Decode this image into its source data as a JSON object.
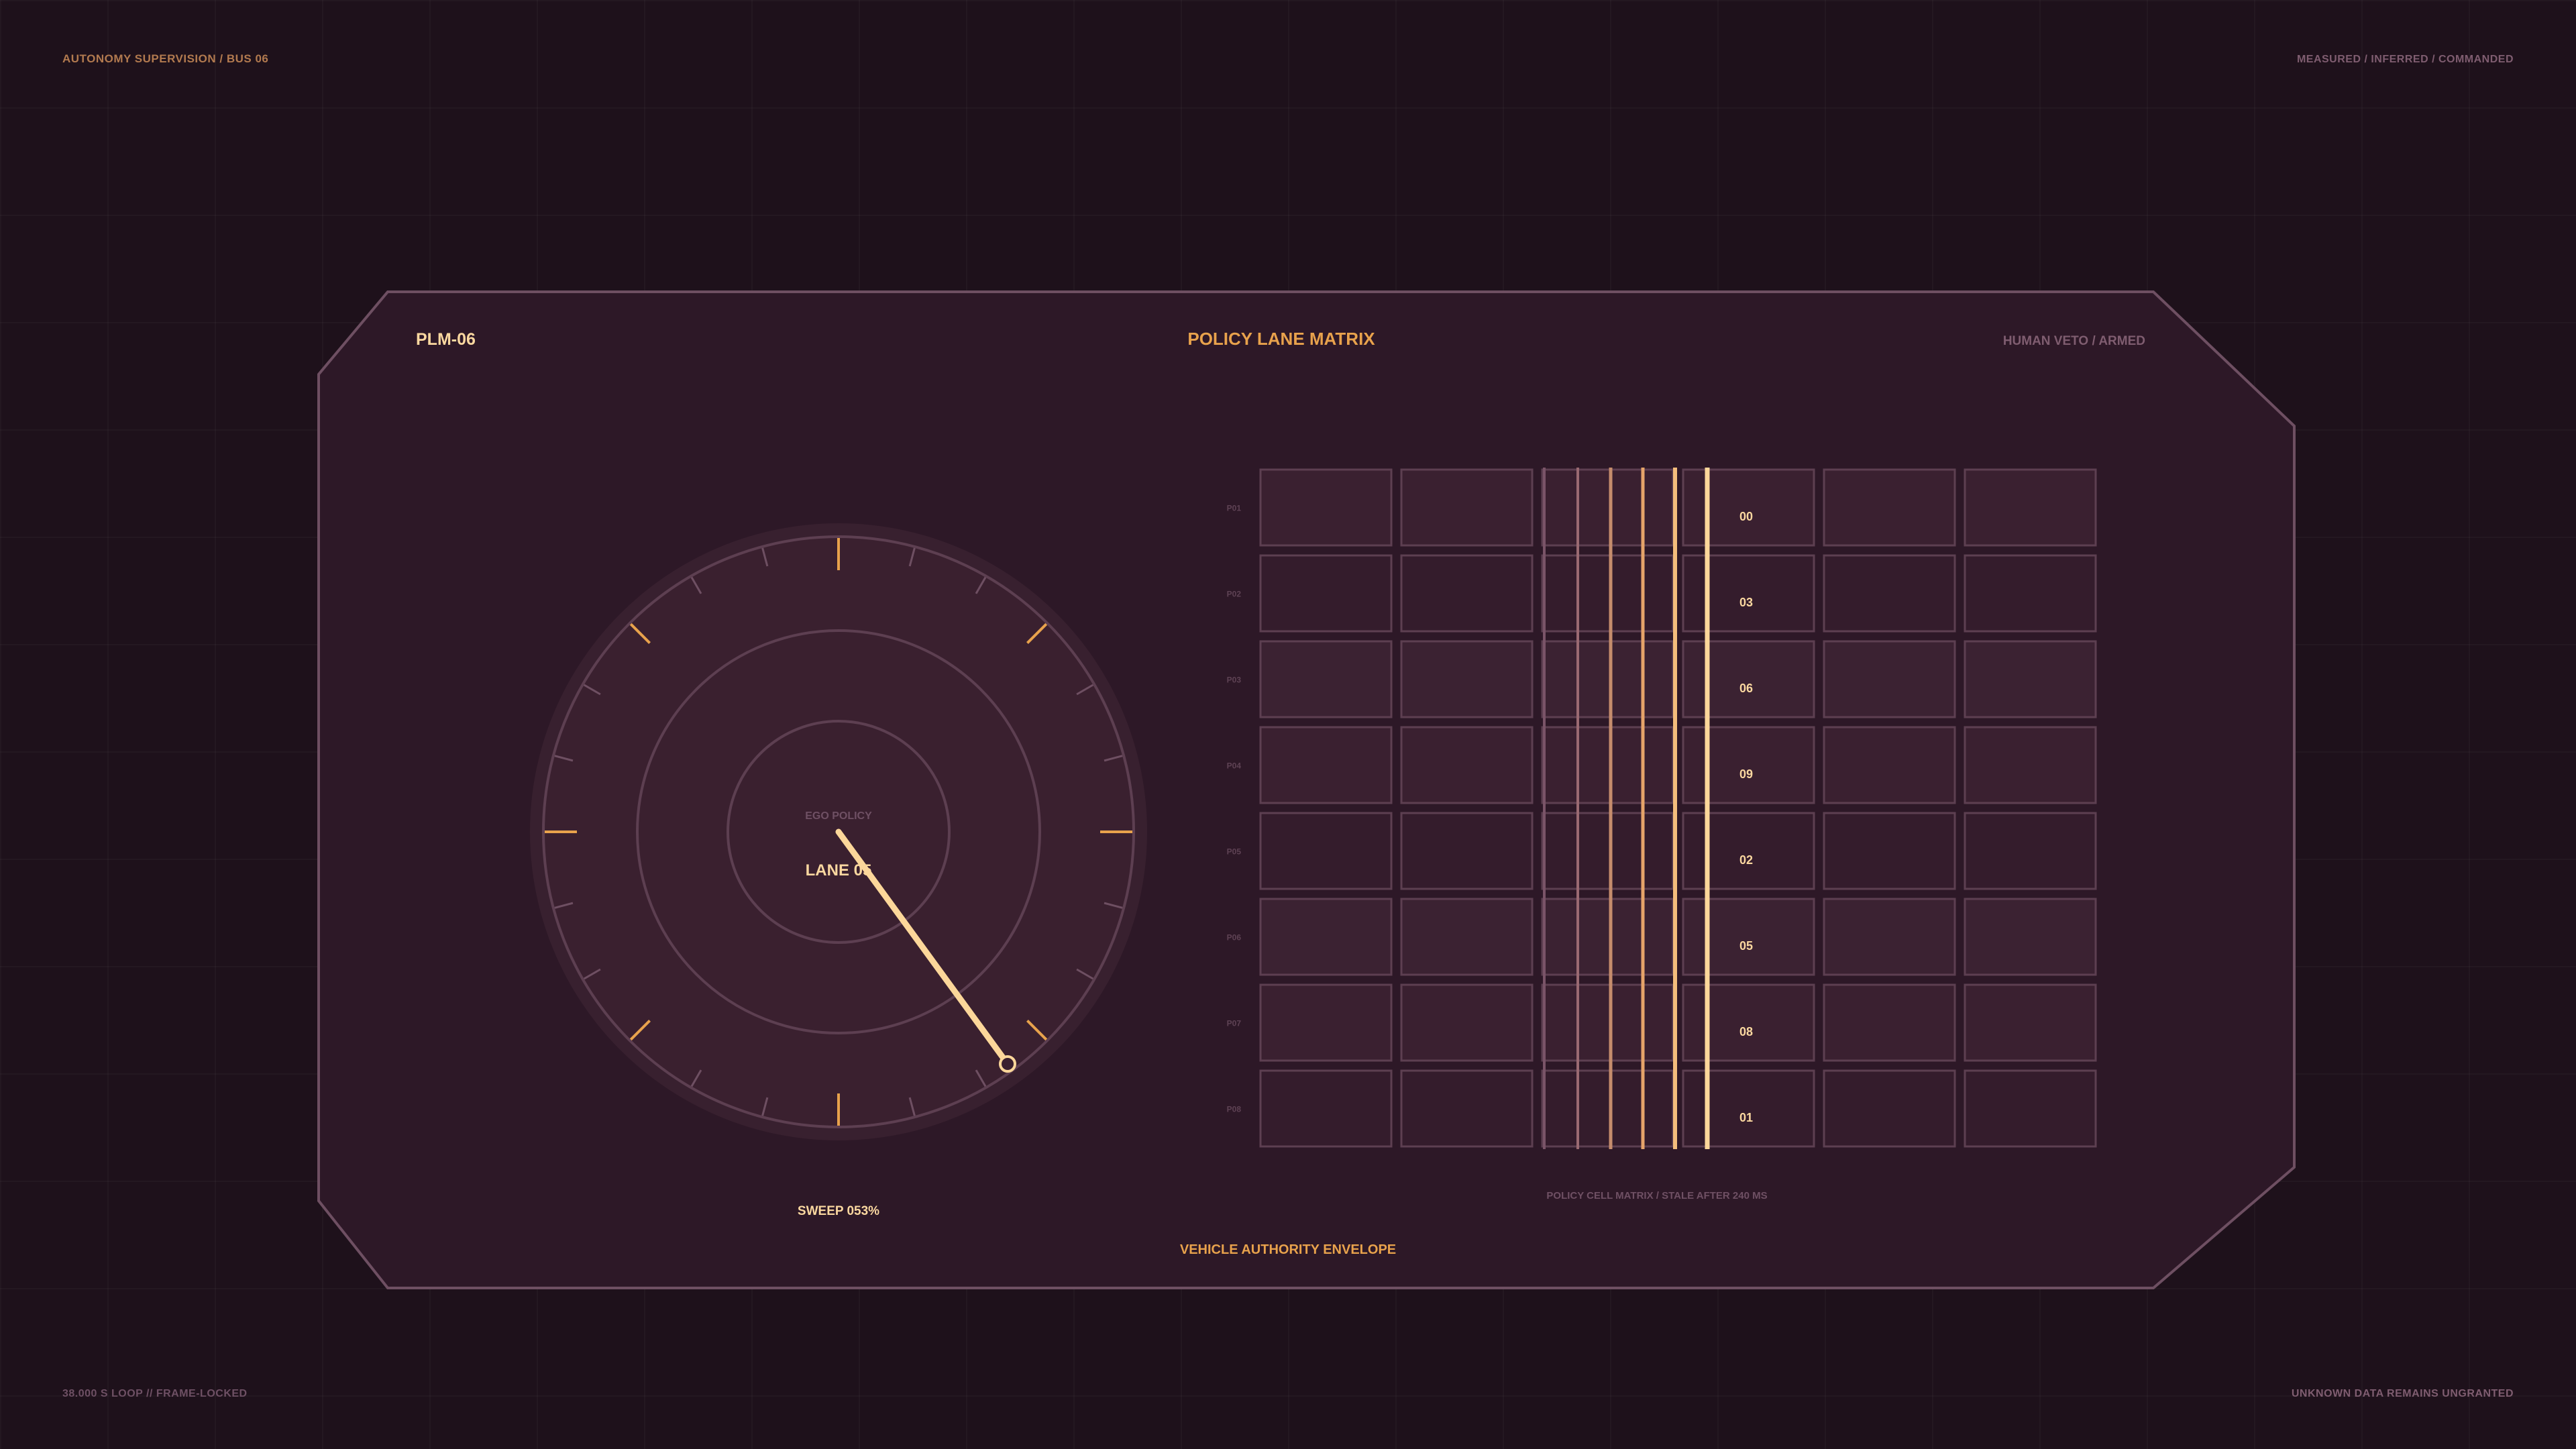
{
  "corners": {
    "top_left": "AUTONOMY SUPERVISION / BUS 06",
    "top_right": "MEASURED  /  INFERRED  /  COMMANDED",
    "bottom_left": "38.000 S LOOP  //  FRAME-LOCKED",
    "bottom_right": "UNKNOWN DATA REMAINS UNGRANTED"
  },
  "panel": {
    "id_label": "PLM-06",
    "title": "POLICY LANE MATRIX",
    "status": "HUMAN VETO / ARMED",
    "footer_title": "VEHICLE AUTHORITY ENVELOPE"
  },
  "dial": {
    "label": "EGO POLICY",
    "value": "LANE 05",
    "sweep_label": "SWEEP 053%",
    "sweep_percent": 53
  },
  "matrix": {
    "rows": [
      "P01",
      "P02",
      "P03",
      "P04",
      "P05",
      "P06",
      "P07",
      "P08"
    ],
    "values": [
      "00",
      "03",
      "06",
      "09",
      "02",
      "05",
      "08",
      "01"
    ],
    "caption": "POLICY CELL MATRIX / STALE AFTER 240 MS"
  },
  "colors": {
    "background": "#1e111b",
    "panel": "#2d1827",
    "accent": "#e8a24c",
    "highlight": "#fcd79a",
    "muted": "#7f5d70"
  }
}
